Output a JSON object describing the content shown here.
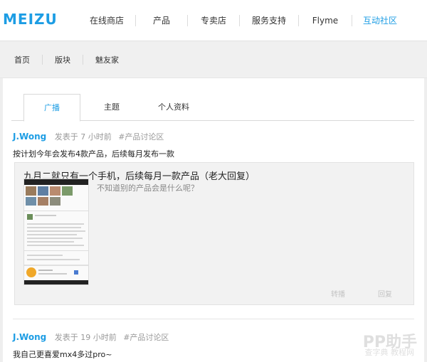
{
  "header": {
    "logo_text": "MEIZU",
    "nav": [
      "在线商店",
      "产品",
      "专卖店",
      "服务支持",
      "Flyme",
      "互动社区"
    ],
    "active_nav": "互动社区"
  },
  "subnav": {
    "items": [
      "首页",
      "版块",
      "魅友家"
    ]
  },
  "tabs": [
    {
      "label": "广播",
      "active": true
    },
    {
      "label": "主题",
      "active": false
    },
    {
      "label": "个人资料",
      "active": false
    }
  ],
  "posts": [
    {
      "author": "J.Wong",
      "time": "发表于 7 小时前",
      "forum": "#产品讨论区",
      "text": "按计划今年会发布4款产品，后续每月发布一款",
      "repost": {
        "title": "九月二就只有一个手机，后续每月一款产品（老大回复）",
        "question": "不知道别的产品会是什么呢？",
        "actions": [
          "转播",
          "回复"
        ]
      }
    },
    {
      "author": "J.Wong",
      "time": "发表于 19 小时前",
      "forum": "#产品讨论区",
      "text": "我自己更喜爱mx4多过pro~"
    }
  ],
  "watermark": {
    "brand": "PP助手",
    "sub": "查字典 教程网"
  },
  "colors": {
    "accent": "#1d9de4",
    "background": "#eeeeee",
    "card": "#ffffff"
  }
}
